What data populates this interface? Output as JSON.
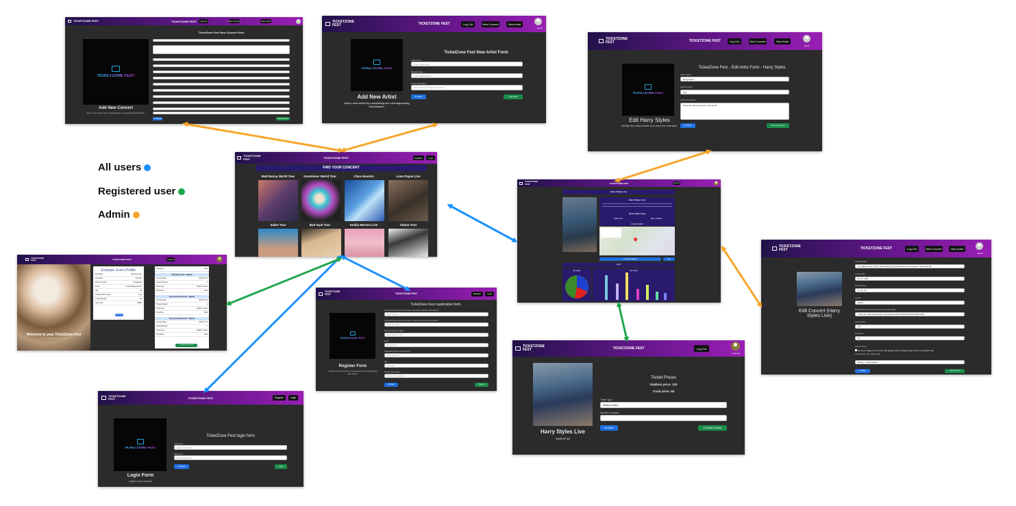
{
  "brand": "TICKETZONE FEST",
  "logo_text": "TICKETZONE FEST",
  "colors": {
    "all": "#1e90ff",
    "registered": "#1fa64a",
    "admin": "#f7a52a",
    "nav_start": "#22124a",
    "nav_end": "#9a1fb4"
  },
  "legend": {
    "all": "All users",
    "registered": "Registered user",
    "admin": "Admin"
  },
  "add_concert": {
    "nav_title": "TICKETZONE FEST",
    "btn1": "Log Out",
    "btn2": "New Concert",
    "btn3": "New Artist",
    "form_title": "TicketZone Fest New Concert Form",
    "caption": "Add New Concert",
    "subcaption": "Add a new concert by completing the corresponding information.",
    "back": "Go Back",
    "submit": "Add Concert"
  },
  "add_artist": {
    "nav_title": "TICKETZONE FEST",
    "btn1": "Log Out",
    "btn2": "New Concert",
    "btn3": "New Artist",
    "user": "admin",
    "form_title": "TicketZone Fest New Artist Form",
    "l1": "Artist name",
    "p1": "Enter Artist name",
    "l2": "Musical style",
    "p2": "Enter Musical style",
    "l3": "Artist information",
    "p3": "Enter information about the artist...",
    "caption": "Add New Artist",
    "subcaption": "Add a new artist by completing the corresponding information.",
    "back": "Go Back",
    "submit": "Add Artist"
  },
  "edit_artist": {
    "nav_title": "TICKETZONE FEST",
    "btn1": "Log Out",
    "btn2": "New Concert",
    "btn3": "New Artist",
    "user": "admin",
    "form_title": "TicketZone Fest - Edit Artist Form - Harry Styles",
    "l1": "Artist Name",
    "v1": "Harry Styles",
    "l2": "Musical style",
    "v2": "Pop",
    "l3": "Artist information",
    "v3": "Ghost the best Pop artist in the world",
    "caption": "Edit Harry Styles",
    "subcaption": "Modify the artist details and save the changes.",
    "back": "Go Back",
    "submit": "Save Changes"
  },
  "home": {
    "nav_title": "TICKETZONE FEST",
    "btn1": "Register",
    "btn2": "Login",
    "banner": "FIND YOUR CONCERT",
    "cards": [
      "Bad Bunny World Tour",
      "Sceretener World Tour",
      "Clara Nuestra",
      "Liam Payne Live",
      "Saiko Tour",
      "Bad Gyal Tour",
      "Emilia Mernes Live",
      "Aitana Tour"
    ]
  },
  "concert_detail": {
    "nav_title": "TICKETZONE FEST",
    "btn1": "Log Out",
    "h1": "Harry Styles Live",
    "h2": "Harry Styles Live",
    "h3": "Harry Styles Pop",
    "date": "2025-07-18",
    "venue": "Nave 1 Madrid",
    "location": "Location Madrid",
    "buy": "Purchase Tickets",
    "go": "Buy",
    "stats": "Grafic",
    "pie": "Pie graph",
    "bar": "Bar graph"
  },
  "profile": {
    "nav_title": "TICKETZONE FEST",
    "btn1": "Log Out",
    "card_title": "Example User's Profile",
    "rows": [
      [
        "Full Name",
        "Example User"
      ],
      [
        "Username",
        "example"
      ],
      [
        "Phone number",
        "611222333"
      ],
      [
        "Email",
        "example@gmail.com"
      ],
      [
        "Age",
        "25"
      ],
      [
        "Favorite Music Style",
        "Pop"
      ],
      [
        "Tickets Bought",
        "30"
      ],
      [
        "User Type",
        "USER"
      ]
    ],
    "edit": "Edit Profile",
    "t1": "Bad Bunny Tour - Madrid",
    "t2": "Sceretener World Tour - Madrid",
    "t3": "Sceretener World Tour - Madrid",
    "tr": [
      [
        "Concert Date",
        "2025-07-18"
      ],
      [
        "Tickets Bought",
        "3"
      ],
      [
        "Ticket type",
        "Stadium stand"
      ],
      [
        "Total Price",
        "120€"
      ]
    ],
    "download": "Download Tickets PDF",
    "caption": "Welcome to your TicketZone Fest",
    "subcaption": "Here you will find your information"
  },
  "register": {
    "nav_title": "TICKETZONE FEST",
    "btn1": "Register",
    "btn2": "Login",
    "form_title": "TicketZone Fest registration form",
    "fields": [
      [
        "Full name (Only accepts lowercase, uppercase characters and spaces)",
        "Enter full name"
      ],
      [
        "Username (only accepts lowercase, uppercase characters and spaces)",
        "Enter Username"
      ],
      [
        "Phone number of 9 digits",
        "Enter Phone number"
      ],
      [
        "Email",
        "Enter Email"
      ],
      [
        "Password (minimum 8 characters)",
        "Enter Password"
      ],
      [
        "Age",
        "Enter age"
      ],
      [
        "Favorite Music Style",
        "Select your music style"
      ]
    ],
    "caption": "Register Form",
    "subcaption": "Create your account by completing the corresponding information.",
    "back": "Go Back",
    "submit": "Register"
  },
  "login": {
    "nav_title": "TICKETZONE FEST",
    "btn1": "Register",
    "btn2": "Login",
    "form_title": "TicketZone Fest login form",
    "l1": "Username",
    "p1": "Enter Username",
    "l2": "Password",
    "p2": "Enter Password",
    "caption": "Login Form",
    "subcaption": "Login to your account.",
    "back": "Go Back",
    "submit": "Login"
  },
  "tickets": {
    "nav_title": "TICKETZONE FEST",
    "btn1": "Log Out",
    "user": "example",
    "heading": "Ticket Prices",
    "stadium": "Stadium price: 120",
    "track": "Track price: 60",
    "l1": "Ticket Type",
    "v1": "Stadium stand",
    "l2": "Number of tickets",
    "caption": "Harry Styles Live",
    "date": "2025-07-18",
    "back": "Go Back",
    "submit": "Purchase Tickets"
  },
  "edit_concert": {
    "nav_title": "TICKETZONE FEST",
    "btn1": "Log Out",
    "btn2": "New Concert",
    "btn3": "New Artist",
    "user": "admin",
    "l1": "Concert Details",
    "v1": "The biggest concert of Harry Styles featuring his greatest hits and new releases. This concert will",
    "l2": "Concert date",
    "v2": "18 / 07 / 2025",
    "l3": "Concert timing",
    "v3": "19 : 00 : 00",
    "l4": "Location",
    "v4": "Madrid",
    "l5": "Map URL (Please insert an iframe from Google Maps)",
    "v5": "<iframe src=\"https://www.google.com/maps/embed?pb=!1m18!1m12!1m3!1d3037.6209...",
    "l6": "Stadium Price",
    "v6": "120",
    "l7": "Track price",
    "v7": "60",
    "l8": "Concert Picture",
    "check": "Remove Image (The concert will appear with a default image when you upload one)",
    "upload": "Upload image (JPG, JPEG, PNG)",
    "file": "Browse... No file selected.",
    "caption": "Edit Concert (Harry Styles Live)",
    "back": "Go Back",
    "submit": "Add Concert"
  }
}
